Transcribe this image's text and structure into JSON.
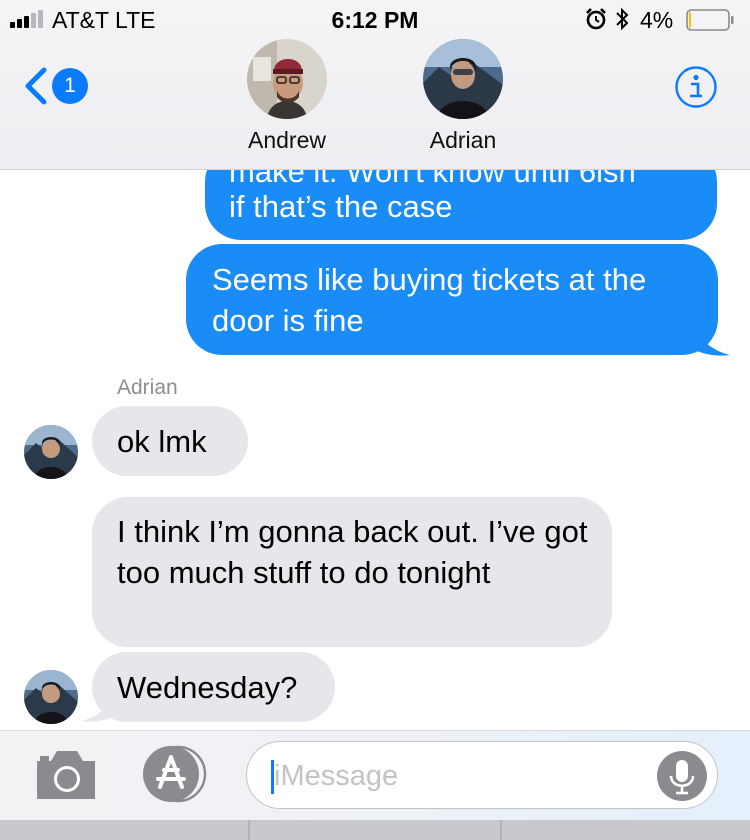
{
  "status_bar": {
    "carrier": "AT&T   LTE",
    "time": "6:12 PM",
    "battery_percent": "4%",
    "battery_level": 0.04,
    "signal_bars_filled": 3,
    "signal_bars_total": 5,
    "icons": [
      "signal-icon",
      "alarm-icon",
      "bluetooth-icon",
      "battery-icon"
    ]
  },
  "header": {
    "back_badge": "1",
    "contacts": [
      {
        "name": "Andrew",
        "avatar": "avatar-andrew"
      },
      {
        "name": "Adrian",
        "avatar": "avatar-adrian"
      }
    ],
    "info_icon": "info-icon"
  },
  "messages": [
    {
      "from": "me",
      "text_partial": "make it. Won't know until 6ish",
      "text": "if that’s the case"
    },
    {
      "from": "me",
      "text": "Seems like buying tickets at the door is fine"
    },
    {
      "from": "Adrian",
      "sender_label": "Adrian",
      "text": "ok lmk"
    },
    {
      "from": "Adrian",
      "text": "I think I’m gonna back out. I’ve got too much stuff to do tonight"
    },
    {
      "from": "Adrian",
      "text": "Wednesday?"
    }
  ],
  "input_bar": {
    "placeholder": "iMessage",
    "icons": [
      "camera-icon",
      "app-store-icon",
      "microphone-icon"
    ]
  },
  "colors": {
    "sent_bubble": "#1a8cf7",
    "received_bubble": "#e6e6eb",
    "accent": "#0a7bff",
    "header_bg": "#f4f4f6"
  }
}
